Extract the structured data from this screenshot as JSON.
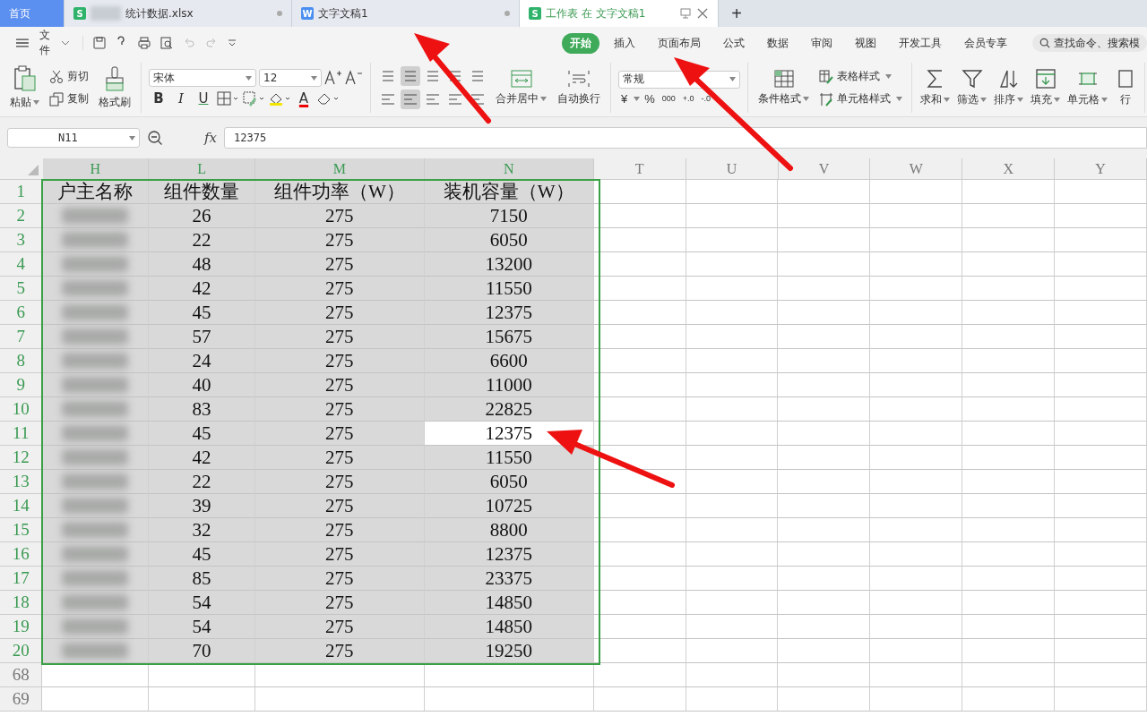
{
  "tabs": [
    {
      "label": "首页",
      "kind": "home",
      "selected": false
    },
    {
      "label": "统计数据.xlsx",
      "kind": "sheet",
      "icon_letter": "S",
      "selected": false,
      "blurred": true
    },
    {
      "label": "文字文稿1",
      "kind": "doc",
      "icon_letter": "W",
      "selected": false
    },
    {
      "label": "工作表 在 文字文稿1",
      "kind": "sheet",
      "icon_letter": "S",
      "selected": true
    }
  ],
  "new_tab": "+",
  "file_menu": "文件",
  "menu_tabs": [
    {
      "label": "开始",
      "selected": true
    },
    {
      "label": "插入",
      "selected": false
    },
    {
      "label": "页面布局",
      "selected": false
    },
    {
      "label": "公式",
      "selected": false
    },
    {
      "label": "数据",
      "selected": false
    },
    {
      "label": "审阅",
      "selected": false
    },
    {
      "label": "视图",
      "selected": false
    },
    {
      "label": "开发工具",
      "selected": false
    },
    {
      "label": "会员专享",
      "selected": false
    }
  ],
  "search": {
    "placeholder": "查找命令、搜索模"
  },
  "clipboard": {
    "paste": "粘贴",
    "cut": "剪切",
    "copy": "复制",
    "format_painter": "格式刷"
  },
  "font": {
    "family": "宋体",
    "size": "12",
    "bold": "B",
    "italic": "I",
    "underline": "U",
    "font_color_letter": "A"
  },
  "alignment": {
    "merge": "合并居中",
    "wrap": "自动换行"
  },
  "number": {
    "format": "常规",
    "currency": "¥",
    "percent": "%",
    "thousands": "000",
    "inc": "+.0",
    "dec": "-.0"
  },
  "styles": {
    "conditional": "条件格式",
    "table_style": "表格样式",
    "cell_style": "单元格样式"
  },
  "editing": [
    {
      "label": "求和"
    },
    {
      "label": "筛选"
    },
    {
      "label": "排序"
    },
    {
      "label": "填充"
    },
    {
      "label": "单元格"
    },
    {
      "label": "行"
    }
  ],
  "name_box": "N11",
  "fx": "fx",
  "formula": "12375",
  "columns": [
    {
      "label": "H",
      "selected": true
    },
    {
      "label": "L",
      "selected": true
    },
    {
      "label": "M",
      "selected": true
    },
    {
      "label": "N",
      "selected": true
    },
    {
      "label": "T",
      "selected": false
    },
    {
      "label": "U",
      "selected": false
    },
    {
      "label": "V",
      "selected": false
    },
    {
      "label": "W",
      "selected": false
    },
    {
      "label": "X",
      "selected": false
    },
    {
      "label": "Y",
      "selected": false
    }
  ],
  "rows": [
    {
      "num": "1",
      "selected": true,
      "active": false,
      "cells": [
        "户主名称",
        "组件数量",
        "组件功率（W）",
        "装机容量（W）"
      ]
    },
    {
      "num": "2",
      "selected": true,
      "active": false,
      "blurred": true,
      "cells": [
        "",
        "26",
        "275",
        "7150"
      ]
    },
    {
      "num": "3",
      "selected": true,
      "active": false,
      "blurred": true,
      "cells": [
        "",
        "22",
        "275",
        "6050"
      ]
    },
    {
      "num": "4",
      "selected": true,
      "active": false,
      "blurred": true,
      "cells": [
        "",
        "48",
        "275",
        "13200"
      ]
    },
    {
      "num": "5",
      "selected": true,
      "active": false,
      "blurred": true,
      "cells": [
        "",
        "42",
        "275",
        "11550"
      ]
    },
    {
      "num": "6",
      "selected": true,
      "active": false,
      "blurred": true,
      "cells": [
        "",
        "45",
        "275",
        "12375"
      ]
    },
    {
      "num": "7",
      "selected": true,
      "active": false,
      "blurred": true,
      "cells": [
        "",
        "57",
        "275",
        "15675"
      ]
    },
    {
      "num": "8",
      "selected": true,
      "active": false,
      "blurred": true,
      "cells": [
        "",
        "24",
        "275",
        "6600"
      ]
    },
    {
      "num": "9",
      "selected": true,
      "active": false,
      "blurred": true,
      "cells": [
        "",
        "40",
        "275",
        "11000"
      ]
    },
    {
      "num": "10",
      "selected": true,
      "active": false,
      "blurred": true,
      "cells": [
        "",
        "83",
        "275",
        "22825"
      ]
    },
    {
      "num": "11",
      "selected": true,
      "active": true,
      "blurred": true,
      "cells": [
        "",
        "45",
        "275",
        "12375"
      ]
    },
    {
      "num": "12",
      "selected": true,
      "active": false,
      "blurred": true,
      "cells": [
        "",
        "42",
        "275",
        "11550"
      ]
    },
    {
      "num": "13",
      "selected": true,
      "active": false,
      "blurred": true,
      "cells": [
        "",
        "22",
        "275",
        "6050"
      ]
    },
    {
      "num": "14",
      "selected": true,
      "active": false,
      "blurred": true,
      "cells": [
        "",
        "39",
        "275",
        "10725"
      ]
    },
    {
      "num": "15",
      "selected": true,
      "active": false,
      "blurred": true,
      "cells": [
        "",
        "32",
        "275",
        "8800"
      ]
    },
    {
      "num": "16",
      "selected": true,
      "active": false,
      "blurred": true,
      "cells": [
        "",
        "45",
        "275",
        "12375"
      ]
    },
    {
      "num": "17",
      "selected": true,
      "active": false,
      "blurred": true,
      "cells": [
        "",
        "85",
        "275",
        "23375"
      ]
    },
    {
      "num": "18",
      "selected": true,
      "active": false,
      "blurred": true,
      "cells": [
        "",
        "54",
        "275",
        "14850"
      ]
    },
    {
      "num": "19",
      "selected": true,
      "active": false,
      "blurred": true,
      "cells": [
        "",
        "54",
        "275",
        "14850"
      ]
    },
    {
      "num": "20",
      "selected": true,
      "active": false,
      "blurred": true,
      "cells": [
        "",
        "70",
        "275",
        "19250"
      ]
    },
    {
      "num": "68",
      "selected": false,
      "active": false,
      "cells": [
        "",
        "",
        "",
        ""
      ]
    },
    {
      "num": "69",
      "selected": false,
      "active": false,
      "cells": [
        "",
        "",
        "",
        ""
      ]
    }
  ]
}
